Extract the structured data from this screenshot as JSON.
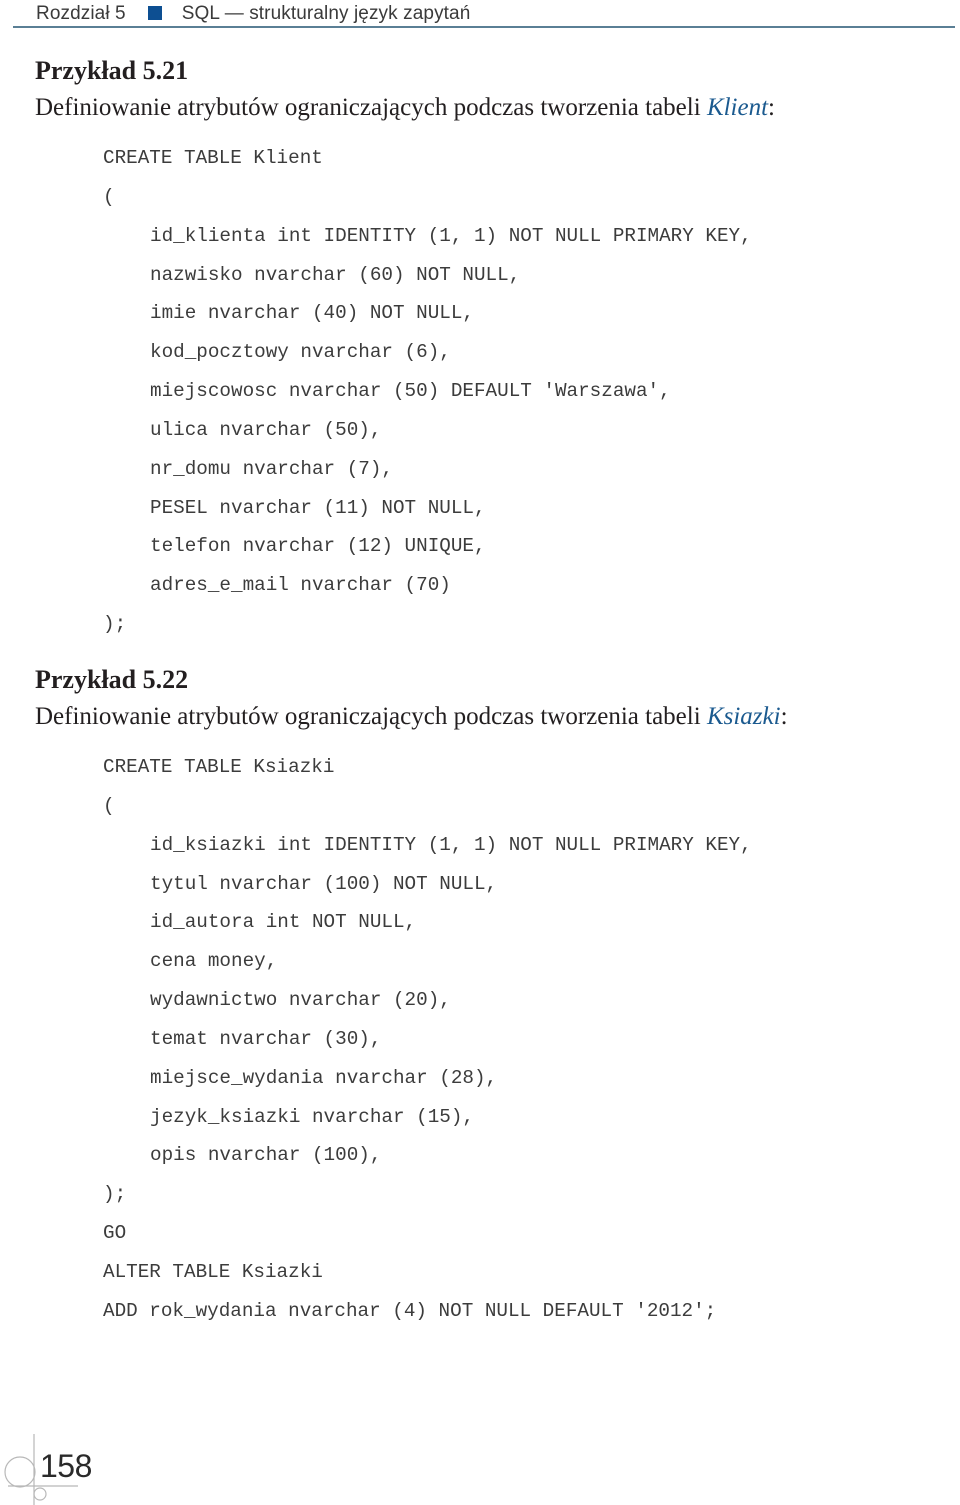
{
  "running_head": {
    "chapter": "Rozdział 5",
    "title": "SQL — strukturalny język zapytań",
    "accent_color": "#0d4f92"
  },
  "examples": [
    {
      "title": "Przykład 5.21",
      "description_prefix": "Definiowanie atrybutów ograniczających podczas tworzenia tabeli ",
      "table_name": "Klient",
      "description_suffix": ":",
      "code": [
        {
          "text": "CREATE TABLE Klient",
          "indent": false
        },
        {
          "text": "(",
          "indent": false
        },
        {
          "text": "id_klienta int IDENTITY (1, 1) NOT NULL PRIMARY KEY,",
          "indent": true
        },
        {
          "text": "nazwisko nvarchar (60) NOT NULL,",
          "indent": true
        },
        {
          "text": "imie nvarchar (40) NOT NULL,",
          "indent": true
        },
        {
          "text": "kod_pocztowy nvarchar (6),",
          "indent": true
        },
        {
          "text": "miejscowosc nvarchar (50) DEFAULT 'Warszawa',",
          "indent": true
        },
        {
          "text": "ulica nvarchar (50),",
          "indent": true
        },
        {
          "text": "nr_domu nvarchar (7),",
          "indent": true
        },
        {
          "text": "PESEL nvarchar (11) NOT NULL,",
          "indent": true
        },
        {
          "text": "telefon nvarchar (12) UNIQUE,",
          "indent": true
        },
        {
          "text": "adres_e_mail nvarchar (70)",
          "indent": true
        },
        {
          "text": ");",
          "indent": false
        }
      ]
    },
    {
      "title": "Przykład 5.22",
      "description_prefix": "Definiowanie atrybutów ograniczających podczas tworzenia tabeli ",
      "table_name": "Ksiazki",
      "description_suffix": ":",
      "code": [
        {
          "text": "CREATE TABLE Ksiazki",
          "indent": false
        },
        {
          "text": "(",
          "indent": false
        },
        {
          "text": "id_ksiazki int IDENTITY (1, 1) NOT NULL PRIMARY KEY,",
          "indent": true
        },
        {
          "text": "tytul nvarchar (100) NOT NULL,",
          "indent": true
        },
        {
          "text": "id_autora int NOT NULL,",
          "indent": true
        },
        {
          "text": "cena money,",
          "indent": true
        },
        {
          "text": "wydawnictwo nvarchar (20),",
          "indent": true
        },
        {
          "text": "temat nvarchar (30),",
          "indent": true
        },
        {
          "text": "miejsce_wydania nvarchar (28),",
          "indent": true
        },
        {
          "text": "jezyk_ksiazki nvarchar (15),",
          "indent": true
        },
        {
          "text": "opis nvarchar (100),",
          "indent": true
        },
        {
          "text": ");",
          "indent": false
        },
        {
          "text": "GO",
          "indent": false
        },
        {
          "text": "ALTER TABLE Ksiazki",
          "indent": false
        },
        {
          "text": "ADD rok_wydania nvarchar (4) NOT NULL DEFAULT '2012';",
          "indent": false
        }
      ]
    }
  ],
  "footer": {
    "page_number": "158",
    "ornament_icon": "circles-crosshair-icon"
  }
}
